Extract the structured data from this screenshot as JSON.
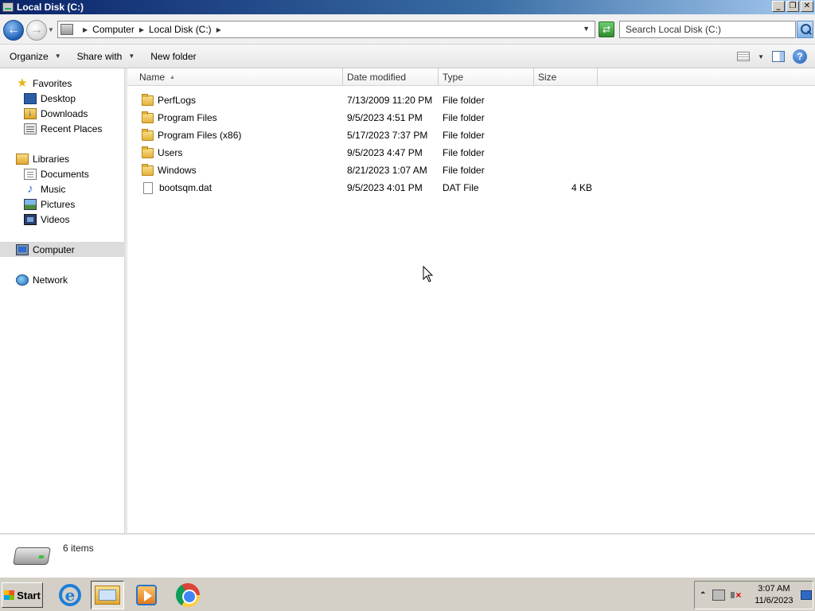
{
  "window": {
    "title": "Local Disk (C:)"
  },
  "address": {
    "crumbs": [
      "Computer",
      "Local Disk (C:)"
    ],
    "search_placeholder": "Search Local Disk (C:)"
  },
  "toolbar": {
    "organize": "Organize",
    "share_with": "Share with",
    "new_folder": "New folder"
  },
  "nav": {
    "favorites": "Favorites",
    "desktop": "Desktop",
    "downloads": "Downloads",
    "recent_places": "Recent Places",
    "libraries": "Libraries",
    "documents": "Documents",
    "music": "Music",
    "pictures": "Pictures",
    "videos": "Videos",
    "computer": "Computer",
    "network": "Network"
  },
  "columns": {
    "name": "Name",
    "date_modified": "Date modified",
    "type": "Type",
    "size": "Size"
  },
  "files": [
    {
      "name": "PerfLogs",
      "date": "7/13/2009 11:20 PM",
      "type": "File folder",
      "size": ""
    },
    {
      "name": "Program Files",
      "date": "9/5/2023 4:51 PM",
      "type": "File folder",
      "size": ""
    },
    {
      "name": "Program Files (x86)",
      "date": "5/17/2023 7:37 PM",
      "type": "File folder",
      "size": ""
    },
    {
      "name": "Users",
      "date": "9/5/2023 4:47 PM",
      "type": "File folder",
      "size": ""
    },
    {
      "name": "Windows",
      "date": "8/21/2023 1:07 AM",
      "type": "File folder",
      "size": ""
    },
    {
      "name": "bootsqm.dat",
      "date": "9/5/2023 4:01 PM",
      "type": "DAT File",
      "size": "4 KB"
    }
  ],
  "details": {
    "item_count": "6 items"
  },
  "taskbar": {
    "start": "Start",
    "time": "3:07 AM",
    "date": "11/6/2023"
  },
  "colors": {
    "titlebar": "#0a246a",
    "taskbar": "#d4d0c8",
    "nav_selected": "#dcdcdc"
  }
}
